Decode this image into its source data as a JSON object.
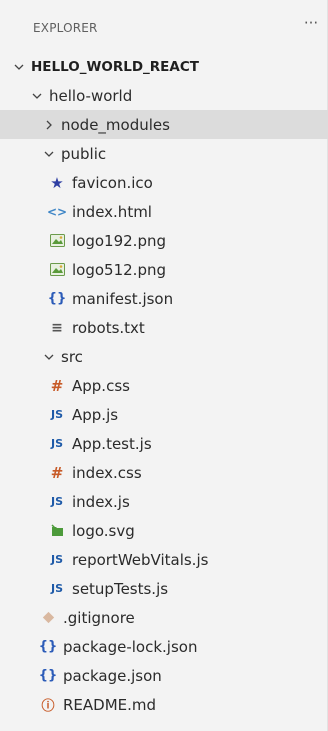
{
  "explorer": {
    "title": "EXPLORER",
    "more_label": "···"
  },
  "tree": [
    {
      "label": "HELLO_WORLD_REACT",
      "type": "root",
      "indent": 0,
      "expanded": true
    },
    {
      "label": "hello-world",
      "type": "folder",
      "indent": 1,
      "expanded": true
    },
    {
      "label": "node_modules",
      "type": "folder",
      "indent": 2,
      "expanded": false,
      "selected": true
    },
    {
      "label": "public",
      "type": "folder",
      "indent": 2,
      "expanded": true
    },
    {
      "label": "favicon.ico",
      "type": "file",
      "icon": "star-icon",
      "indent": 3
    },
    {
      "label": "index.html",
      "type": "file",
      "icon": "html-icon",
      "indent": 3
    },
    {
      "label": "logo192.png",
      "type": "file",
      "icon": "image-icon",
      "indent": 3
    },
    {
      "label": "logo512.png",
      "type": "file",
      "icon": "image-icon",
      "indent": 3
    },
    {
      "label": "manifest.json",
      "type": "file",
      "icon": "json-icon",
      "indent": 3
    },
    {
      "label": "robots.txt",
      "type": "file",
      "icon": "text-lines-icon",
      "indent": 3
    },
    {
      "label": "src",
      "type": "folder",
      "indent": 2,
      "expanded": true
    },
    {
      "label": "App.css",
      "type": "file",
      "icon": "css-hash-icon",
      "indent": 3
    },
    {
      "label": "App.js",
      "type": "file",
      "icon": "js-icon",
      "indent": 3
    },
    {
      "label": "App.test.js",
      "type": "file",
      "icon": "js-icon",
      "indent": 3
    },
    {
      "label": "index.css",
      "type": "file",
      "icon": "css-hash-icon",
      "indent": 3
    },
    {
      "label": "index.js",
      "type": "file",
      "icon": "js-icon",
      "indent": 3
    },
    {
      "label": "logo.svg",
      "type": "file",
      "icon": "svg-icon",
      "indent": 3
    },
    {
      "label": "reportWebVitals.js",
      "type": "file",
      "icon": "js-icon",
      "indent": 3
    },
    {
      "label": "setupTests.js",
      "type": "file",
      "icon": "js-icon",
      "indent": 3
    },
    {
      "label": ".gitignore",
      "type": "file",
      "icon": "git-icon",
      "indent": 2
    },
    {
      "label": "package-lock.json",
      "type": "file",
      "icon": "json-icon",
      "indent": 2
    },
    {
      "label": "package.json",
      "type": "file",
      "icon": "json-icon",
      "indent": 2
    },
    {
      "label": "README.md",
      "type": "file",
      "icon": "info-icon",
      "indent": 2
    }
  ],
  "icon_glyphs": {
    "js": "JS",
    "css_hash": "#",
    "json": "{}",
    "info": "ⓘ",
    "star": "★",
    "html": "<>",
    "lines": "≡"
  },
  "colors": {
    "background": "#f3f3f3",
    "selected_row": "#dcdcdc",
    "js": "#1e5aa8",
    "css": "#c75a27",
    "json": "#2b5bb8",
    "star": "#2f3fa3"
  }
}
